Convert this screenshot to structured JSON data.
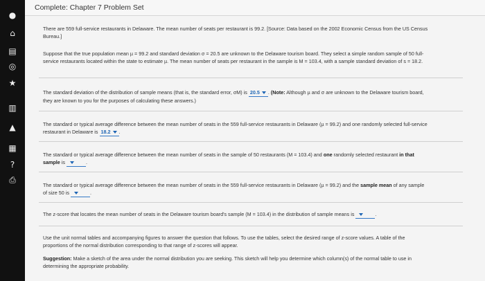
{
  "window": {
    "title": "Complete: Chapter 7 Problem Set"
  },
  "sidebar_icons": [
    "pin-icon",
    "home-icon",
    "book-icon",
    "circle-arrow-icon",
    "star-icon",
    "notes-icon",
    "graduation-cap-icon",
    "calculator-icon",
    "help-icon",
    "print-icon"
  ],
  "p1": {
    "text": "There are 559 full-service restaurants in Delaware. The mean number of seats per restaurant is 99.2. [Source: Data based on the 2002 Economic Census from the US Census Bureau.]"
  },
  "p2": {
    "text": "Suppose that the true population mean µ = 99.2 and standard deviation σ = 20.5 are unknown to the Delaware tourism board. They select a simple random sample of 50 full-service restaurants located within the state to estimate µ. The mean number of seats per restaurant in the sample is M = 103.4, with a sample standard deviation of s = 18.2."
  },
  "q1": {
    "before": "The standard deviation of the distribution of sample means (that is, the standard error, σM) is",
    "answer": "20.5",
    "note_label": "(Note:",
    "note_text": "Although µ and σ are unknown to the Delaware tourism board, they are known to you for the purposes of calculating these answers.)"
  },
  "q2": {
    "before": "The standard or typical average difference between the mean number of seats in the 559 full-service restaurants in Delaware (µ = 99.2) and one randomly selected full-service restaurant in Delaware is",
    "answer": "18.2",
    "after": "."
  },
  "q3": {
    "before": "The standard or typical average difference between the mean number of seats in the sample of 50 restaurants (M = 103.4) and",
    "bold1": "one",
    "mid": "randomly selected restaurant",
    "bold2": "in that sample",
    "after": "is",
    "answer": "",
    "end": "."
  },
  "q4": {
    "before": "The standard or typical average difference between the mean number of seats in the 559 full-service restaurants in Delaware (µ = 99.2) and the",
    "bold": "sample mean",
    "after": "of any sample of size 50 is",
    "answer": "",
    "end": "."
  },
  "q5": {
    "before": "The z-score that locates the mean number of seats in the Delaware tourism board's sample (M = 103.4) in the distribution of sample means is",
    "answer": "",
    "end": "."
  },
  "p3": {
    "text": "Use the unit normal tables and accompanying figures to answer the question that follows. To use the tables, select the desired range of z-score values. A table of the proportions of the normal distribution corresponding to that range of z-scores will appear."
  },
  "p4": {
    "label": "Suggestion:",
    "text": "Make a sketch of the area under the normal distribution you are seeking. This sketch will help you determine which column(s) of the normal table to use in determining the appropriate probability."
  }
}
